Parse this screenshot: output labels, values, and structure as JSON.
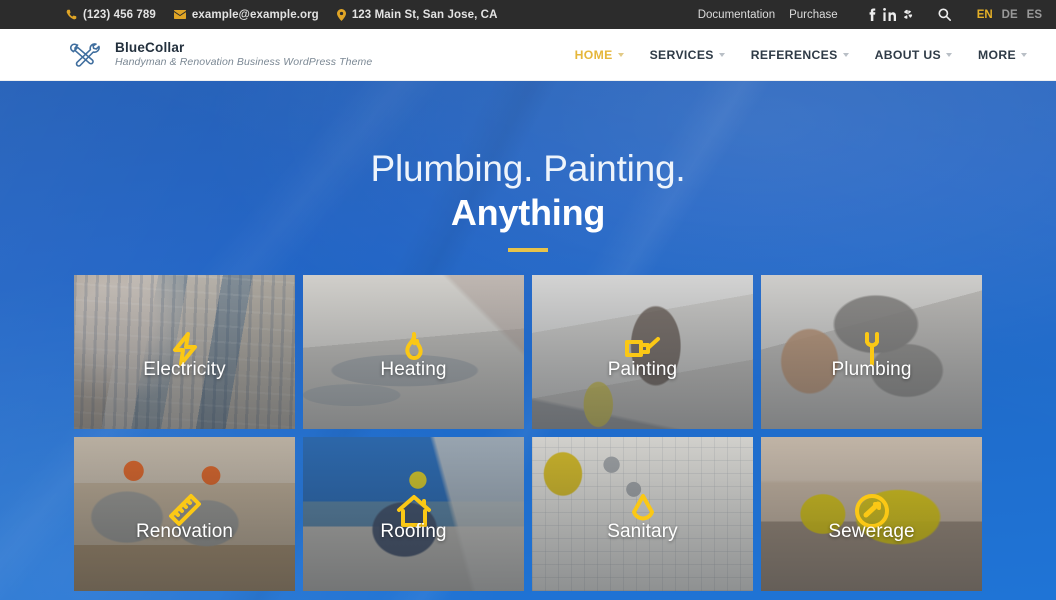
{
  "topbar": {
    "phone": "(123) 456 789",
    "email": "example@example.org",
    "address": "123 Main St, San Jose, CA",
    "links": [
      {
        "label": "Documentation"
      },
      {
        "label": "Purchase"
      }
    ],
    "socials": [
      {
        "name": "facebook-icon",
        "glyph": "f"
      },
      {
        "name": "linkedin-icon",
        "glyph": "in"
      },
      {
        "name": "yelp-icon",
        "glyph": "Y"
      }
    ],
    "search_icon": "search-icon",
    "languages": [
      {
        "code": "EN",
        "active": true
      },
      {
        "code": "DE",
        "active": false
      },
      {
        "code": "ES",
        "active": false
      }
    ]
  },
  "brand": {
    "name": "BlueCollar",
    "tagline": "Handyman & Renovation Business WordPress Theme",
    "icon": "hammer-wrench-icon"
  },
  "nav": {
    "items": [
      {
        "label": "HOME",
        "active": true,
        "has_dropdown": true
      },
      {
        "label": "SERVICES",
        "active": false,
        "has_dropdown": true
      },
      {
        "label": "REFERENCES",
        "active": false,
        "has_dropdown": true
      },
      {
        "label": "ABOUT US",
        "active": false,
        "has_dropdown": true
      },
      {
        "label": "MORE",
        "active": false,
        "has_dropdown": true
      }
    ]
  },
  "hero": {
    "line1": "Plumbing. Painting.",
    "line2": "Anything"
  },
  "tiles": [
    {
      "label": "Electricity",
      "icon": "lightning-bolt-icon",
      "bg": "bg-electricity"
    },
    {
      "label": "Heating",
      "icon": "flame-icon",
      "bg": "bg-heating"
    },
    {
      "label": "Painting",
      "icon": "paint-brush-icon",
      "bg": "bg-painting"
    },
    {
      "label": "Plumbing",
      "icon": "wrench-icon",
      "bg": "bg-plumbing"
    },
    {
      "label": "Renovation",
      "icon": "ruler-icon",
      "bg": "bg-renovation"
    },
    {
      "label": "Roofing",
      "icon": "house-icon",
      "bg": "bg-roofing"
    },
    {
      "label": "Sanitary",
      "icon": "water-drop-icon",
      "bg": "bg-sanitary"
    },
    {
      "label": "Sewerage",
      "icon": "drain-circle-icon",
      "bg": "bg-sewerage"
    }
  ],
  "colors": {
    "topbar_bg": "#2c2c2c",
    "accent_yellow": "#e5b63a",
    "hero_blue": "#2163c4",
    "tile_icon_yellow": "#fbc815",
    "nav_text": "#2f3b47"
  }
}
